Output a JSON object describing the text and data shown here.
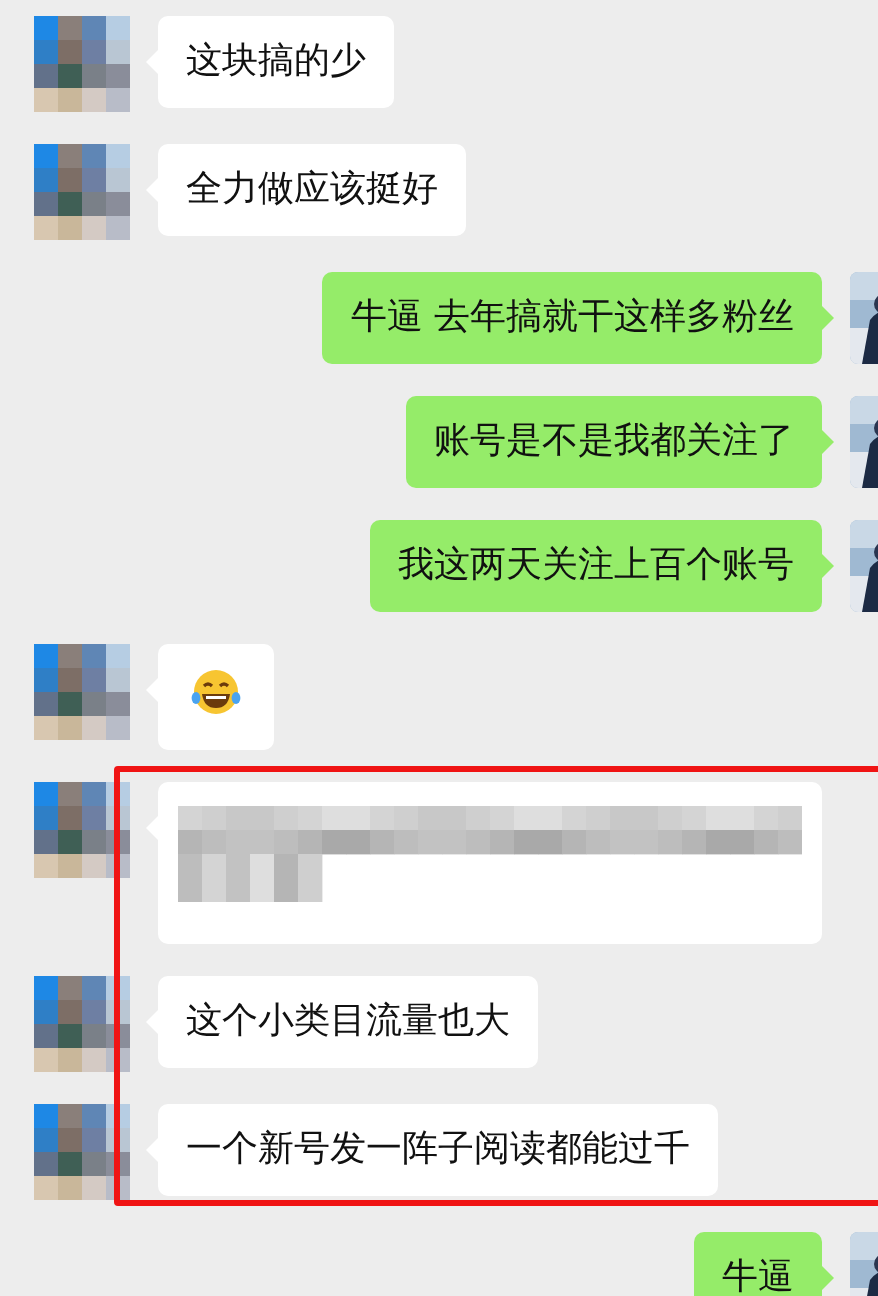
{
  "messages": [
    {
      "kind": "received_text",
      "text": "这块搞的少",
      "highlighted": false
    },
    {
      "kind": "received_text",
      "text": "全力做应该挺好",
      "highlighted": false
    },
    {
      "kind": "sent_text",
      "text": "牛逼 去年搞就干这样多粉丝",
      "highlighted": false
    },
    {
      "kind": "sent_text",
      "text": "账号是不是我都关注了",
      "highlighted": false
    },
    {
      "kind": "sent_text",
      "text": "我这两天关注上百个账号",
      "highlighted": false
    },
    {
      "kind": "received_emoji",
      "highlighted": false
    },
    {
      "kind": "received_redacted",
      "highlighted": true
    },
    {
      "kind": "received_text",
      "text": "这个小类目流量也大",
      "highlighted": true
    },
    {
      "kind": "received_text",
      "text": "一个新号发一阵子阅读都能过千",
      "highlighted": true
    },
    {
      "kind": "sent_text",
      "text": "牛逼",
      "highlighted": false
    }
  ]
}
